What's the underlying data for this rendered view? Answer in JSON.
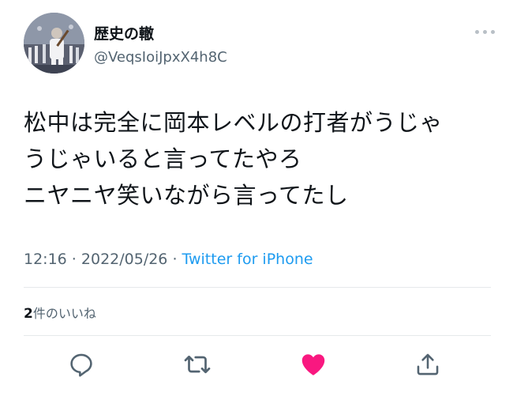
{
  "user": {
    "display_name": "歴史の轍",
    "handle": "@VeqsIoiJpxX4h8C"
  },
  "tweet": {
    "lines": [
      "松中は完全に岡本レベルの打者がうじゃ",
      "うじゃいると言ってたやろ",
      "ニヤニヤ笑いながら言ってたし"
    ]
  },
  "meta": {
    "time": "12:16",
    "separator": " · ",
    "date": "2022/05/26",
    "source": "Twitter for iPhone"
  },
  "stats": {
    "like_count": "2",
    "like_label": "件のいいね"
  },
  "colors": {
    "text": "#0f1419",
    "secondary": "#536471",
    "link": "#1d9bf0",
    "like": "#f91880",
    "divider": "#e6e9eb"
  },
  "icons": {
    "reply": "reply-icon",
    "retweet": "retweet-icon",
    "like": "heart-icon",
    "share": "share-icon",
    "more": "more-icon"
  }
}
